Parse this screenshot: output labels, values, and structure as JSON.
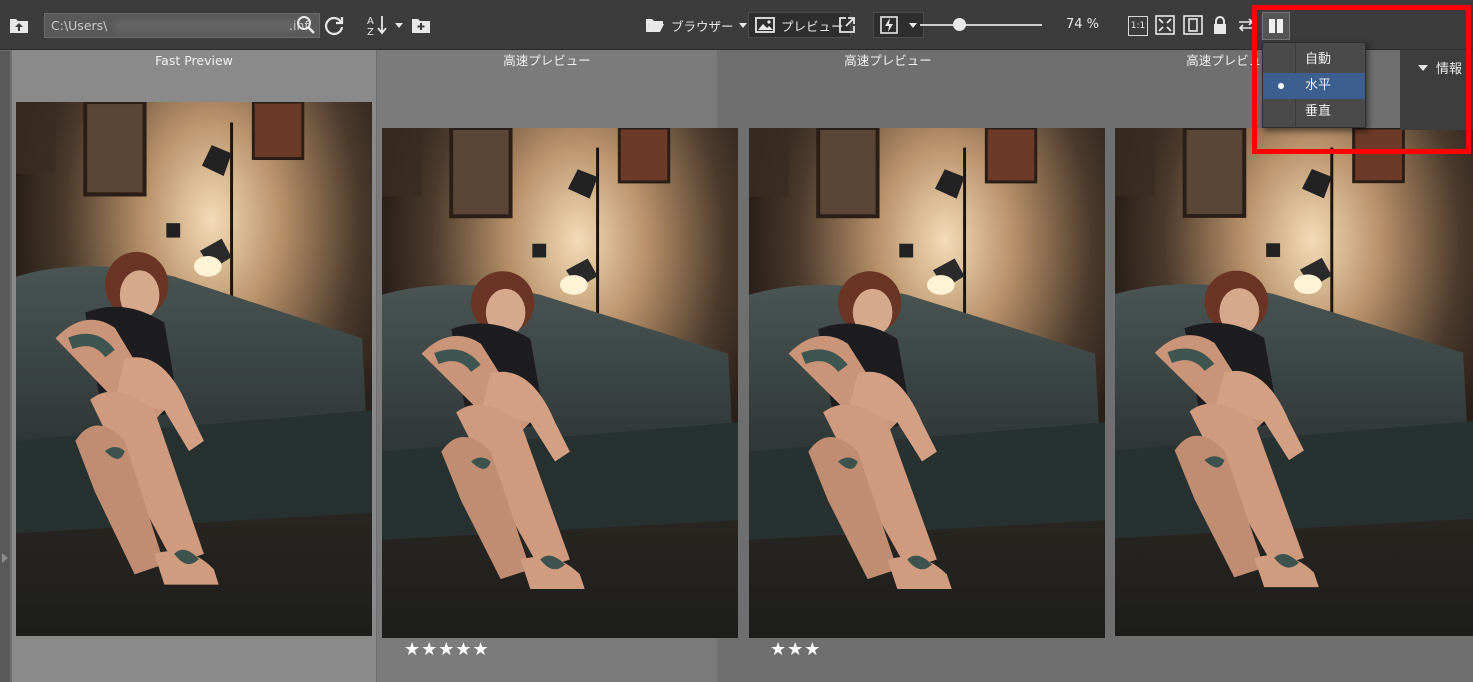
{
  "toolbar": {
    "path_value": "C:\\Users\\",
    "path_suffix": ".inf",
    "browser_label": "ブラウザー",
    "preview_label": "プレビュー",
    "zoom_label": "74 %",
    "one_to_one_label": "1:1",
    "zoom_level": 0.3,
    "icons": [
      "folder-up-icon",
      "search-icon",
      "refresh-icon",
      "sort-az-icon",
      "new-folder-icon",
      "folder-open-icon",
      "image-preview-icon",
      "open-external-icon",
      "flash-icon",
      "fit-screen-icon",
      "fit-height-icon",
      "lock-icon",
      "swap-icon",
      "layout-columns-icon"
    ]
  },
  "layout_menu": {
    "items": [
      {
        "label": "自動",
        "selected": false
      },
      {
        "label": "水平",
        "selected": true
      },
      {
        "label": "垂直",
        "selected": false
      }
    ]
  },
  "info_panel": {
    "label": "情報"
  },
  "cells": [
    {
      "header": "Fast Preview",
      "stars": ""
    },
    {
      "header": "高速プレビュー",
      "stars": "★★★★★"
    },
    {
      "header": "高速プレビュー",
      "stars": "★★★"
    },
    {
      "header": "高速プレビュー",
      "stars": ""
    }
  ],
  "colors": {
    "highlight": "#ff0000",
    "menu_active": "#3d5f8f",
    "toolbar": "#3c3c3c"
  }
}
